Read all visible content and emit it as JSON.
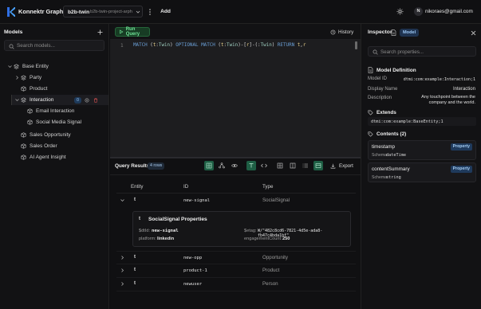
{
  "header": {
    "app_title": "Konnektr Graph",
    "project_name": "b2b-twin",
    "project_id": "b2b-twin-project-arph",
    "add_label": "Add",
    "user_initial": "N",
    "user_email": "nikoraes@gmail.com",
    "icons": [
      "logo-icon",
      "chevron-down-icon",
      "more-vertical-icon",
      "sun-icon"
    ]
  },
  "sidebar": {
    "title": "Models",
    "search_placeholder": "Search models...",
    "tree": [
      {
        "label": "Base Entity",
        "expanded": true
      },
      {
        "label": "Party",
        "expanded": false
      },
      {
        "label": "Product"
      },
      {
        "label": "Interaction",
        "expanded": true,
        "selected": true,
        "count": "0"
      },
      {
        "label": "Email Interaction"
      },
      {
        "label": "Social Media Signal"
      },
      {
        "label": "Sales Opportunity"
      },
      {
        "label": "Sales Order"
      },
      {
        "label": "AI Agent Insight"
      }
    ]
  },
  "editor": {
    "run_label": "Run Query",
    "history_label": "History",
    "line_number": "1",
    "query": "MATCH (t:Twin) OPTIONAL MATCH (t:Twin)-[r]-(:Twin) RETURN t,r"
  },
  "results": {
    "title": "Query Results",
    "count_badge": "4 rows",
    "export_label": "Export",
    "columns": [
      "Entity",
      "ID",
      "Type"
    ],
    "rows": [
      {
        "entity": "t",
        "id": "new-signal",
        "type": "SocialSignal",
        "expanded": true
      },
      {
        "entity": "t",
        "id": "new-opp",
        "type": "Opportunity"
      },
      {
        "entity": "t",
        "id": "product-1",
        "type": "Product"
      },
      {
        "entity": "t",
        "id": "newuser",
        "type": "Person"
      }
    ],
    "detail": {
      "prefix": "t",
      "title": "SocialSignal Properties",
      "props": [
        {
          "key": "$dtId:",
          "value": "new-signal"
        },
        {
          "key": "$etag:",
          "value": "W/\"482c8cd6-7821-4d5e-ada8-fb47c4bda1bf\""
        },
        {
          "key": "platform:",
          "value": "linkedin"
        },
        {
          "key": "engagementCount:",
          "value": "250"
        }
      ]
    }
  },
  "inspector": {
    "title": "Inspector",
    "badge": "Model",
    "search_placeholder": "Search properties...",
    "definition_heading": "Model Definition",
    "definition": [
      {
        "key": "Model ID",
        "value": "dtmi:com:example:Interaction;1"
      },
      {
        "key": "Display Name",
        "value": "Interaction"
      },
      {
        "key": "Description",
        "value": "Any touchpoint between the company and the world."
      }
    ],
    "extends_heading": "Extends",
    "extends_value": "dtmi:com:example:BaseEntity;1",
    "contents_heading": "Contents (2)",
    "contents": [
      {
        "name": "timestamp",
        "badge": "Property",
        "schema_label": "Schema:",
        "schema": "dateTime"
      },
      {
        "name": "contentSummary",
        "badge": "Property",
        "schema_label": "Schema:",
        "schema": "string"
      }
    ]
  },
  "colors": {
    "background": "#0d0d0f",
    "panel": "#121214",
    "editor": "#1d1d1f",
    "accent_green": "#6fe397",
    "accent_blue": "#9cc8f5"
  }
}
